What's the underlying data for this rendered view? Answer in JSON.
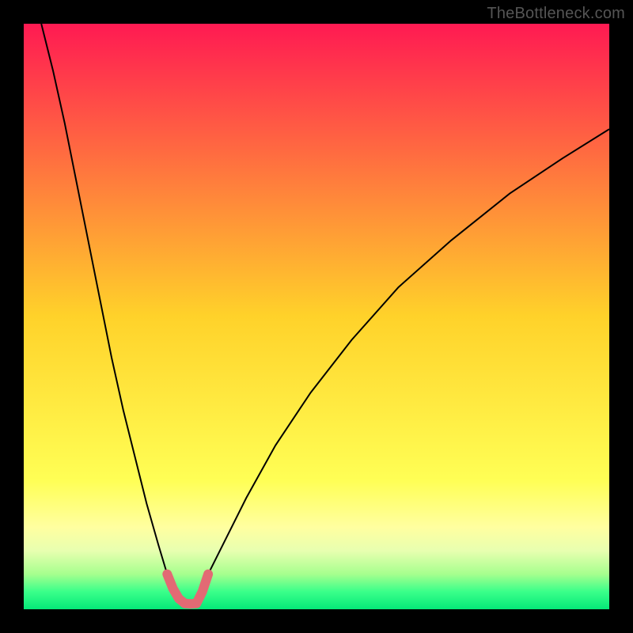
{
  "watermark": "TheBottleneck.com",
  "chart_data": {
    "type": "line",
    "title": "",
    "xlabel": "",
    "ylabel": "",
    "xlim": [
      0,
      1
    ],
    "ylim": [
      0,
      1
    ],
    "background_gradient": {
      "stops": [
        {
          "pos": 0.0,
          "color": "#ff1a52"
        },
        {
          "pos": 0.5,
          "color": "#ffd22a"
        },
        {
          "pos": 0.78,
          "color": "#ffff55"
        },
        {
          "pos": 0.86,
          "color": "#ffffa0"
        },
        {
          "pos": 0.9,
          "color": "#e8ffb0"
        },
        {
          "pos": 0.94,
          "color": "#a6ff8e"
        },
        {
          "pos": 0.97,
          "color": "#3aff8a"
        },
        {
          "pos": 1.0,
          "color": "#05e878"
        }
      ]
    },
    "series": [
      {
        "name": "branch-left",
        "color": "#000000",
        "stroke_width": 2,
        "x": [
          0.03,
          0.05,
          0.07,
          0.09,
          0.11,
          0.13,
          0.15,
          0.17,
          0.19,
          0.21,
          0.23,
          0.245
        ],
        "values": [
          1.0,
          0.92,
          0.83,
          0.73,
          0.63,
          0.53,
          0.43,
          0.34,
          0.26,
          0.18,
          0.11,
          0.06
        ]
      },
      {
        "name": "branch-right",
        "color": "#000000",
        "stroke_width": 2,
        "x": [
          0.315,
          0.34,
          0.38,
          0.43,
          0.49,
          0.56,
          0.64,
          0.73,
          0.83,
          0.92,
          1.0
        ],
        "values": [
          0.06,
          0.11,
          0.19,
          0.28,
          0.37,
          0.46,
          0.55,
          0.63,
          0.71,
          0.77,
          0.82
        ]
      },
      {
        "name": "bucket-left-pink",
        "color": "#e26a74",
        "stroke_width": 12,
        "linecap": "round",
        "x": [
          0.245,
          0.255,
          0.265,
          0.275
        ],
        "values": [
          0.06,
          0.035,
          0.018,
          0.01
        ]
      },
      {
        "name": "bucket-bottom-pink",
        "color": "#e26a74",
        "stroke_width": 12,
        "linecap": "round",
        "x": [
          0.275,
          0.285,
          0.295
        ],
        "values": [
          0.01,
          0.009,
          0.01
        ]
      },
      {
        "name": "bucket-right-pink",
        "color": "#e26a74",
        "stroke_width": 12,
        "linecap": "round",
        "x": [
          0.295,
          0.305,
          0.315
        ],
        "values": [
          0.01,
          0.03,
          0.06
        ]
      }
    ]
  }
}
